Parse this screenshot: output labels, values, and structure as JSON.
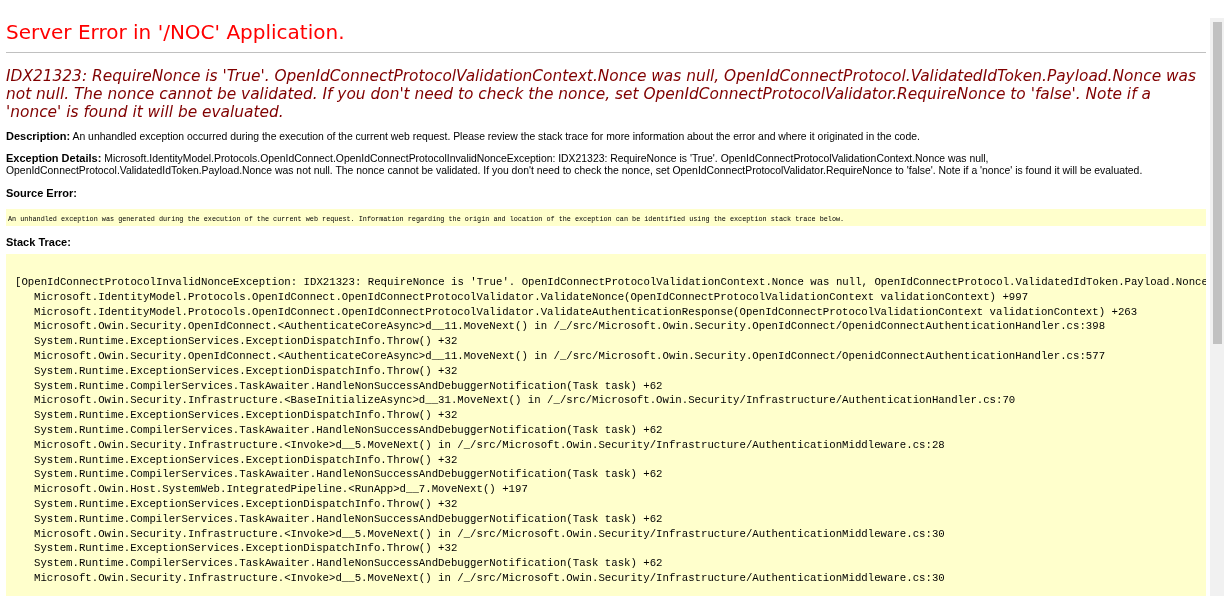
{
  "title": "Server Error in '/NOC' Application.",
  "message": "IDX21323: RequireNonce is 'True'. OpenIdConnectProtocolValidationContext.Nonce was null, OpenIdConnectProtocol.ValidatedIdToken.Payload.Nonce was not null. The nonce cannot be validated. If you don't need to check the nonce, set OpenIdConnectProtocolValidator.RequireNonce to 'false'. Note if a 'nonce' is found it will be evaluated.",
  "description": {
    "label": "Description:",
    "text": "An unhandled exception occurred during the execution of the current web request. Please review the stack trace for more information about the error and where it originated in the code."
  },
  "exception_details": {
    "label": "Exception Details:",
    "text": "Microsoft.IdentityModel.Protocols.OpenIdConnect.OpenIdConnectProtocolInvalidNonceException: IDX21323: RequireNonce is 'True'. OpenIdConnectProtocolValidationContext.Nonce was null, OpenIdConnectProtocol.ValidatedIdToken.Payload.Nonce was not null. The nonce cannot be validated. If you don't need to check the nonce, set OpenIdConnectProtocolValidator.RequireNonce to 'false'. Note if a 'nonce' is found it will be evaluated."
  },
  "source_error": {
    "label": "Source Error:",
    "text": "An unhandled exception was generated during the execution of the current web request. Information regarding the origin and location of the exception can be identified using the exception stack trace below."
  },
  "stack_trace": {
    "label": "Stack Trace:",
    "exception": "[OpenIdConnectProtocolInvalidNonceException: IDX21323: RequireNonce is 'True'. OpenIdConnectProtocolValidationContext.Nonce was null, OpenIdConnectProtocol.ValidatedIdToken.Payload.Nonce",
    "frames": [
      "Microsoft.IdentityModel.Protocols.OpenIdConnect.OpenIdConnectProtocolValidator.ValidateNonce(OpenIdConnectProtocolValidationContext validationContext) +997",
      "Microsoft.IdentityModel.Protocols.OpenIdConnect.OpenIdConnectProtocolValidator.ValidateAuthenticationResponse(OpenIdConnectProtocolValidationContext validationContext) +263",
      "Microsoft.Owin.Security.OpenIdConnect.<AuthenticateCoreAsync>d__11.MoveNext() in /_/src/Microsoft.Owin.Security.OpenIdConnect/OpenidConnectAuthenticationHandler.cs:398",
      "System.Runtime.ExceptionServices.ExceptionDispatchInfo.Throw() +32",
      "Microsoft.Owin.Security.OpenIdConnect.<AuthenticateCoreAsync>d__11.MoveNext() in /_/src/Microsoft.Owin.Security.OpenIdConnect/OpenidConnectAuthenticationHandler.cs:577",
      "System.Runtime.ExceptionServices.ExceptionDispatchInfo.Throw() +32",
      "System.Runtime.CompilerServices.TaskAwaiter.HandleNonSuccessAndDebuggerNotification(Task task) +62",
      "Microsoft.Owin.Security.Infrastructure.<BaseInitializeAsync>d__31.MoveNext() in /_/src/Microsoft.Owin.Security/Infrastructure/AuthenticationHandler.cs:70",
      "System.Runtime.ExceptionServices.ExceptionDispatchInfo.Throw() +32",
      "System.Runtime.CompilerServices.TaskAwaiter.HandleNonSuccessAndDebuggerNotification(Task task) +62",
      "Microsoft.Owin.Security.Infrastructure.<Invoke>d__5.MoveNext() in /_/src/Microsoft.Owin.Security/Infrastructure/AuthenticationMiddleware.cs:28",
      "System.Runtime.ExceptionServices.ExceptionDispatchInfo.Throw() +32",
      "System.Runtime.CompilerServices.TaskAwaiter.HandleNonSuccessAndDebuggerNotification(Task task) +62",
      "Microsoft.Owin.Host.SystemWeb.IntegratedPipeline.<RunApp>d__7.MoveNext() +197",
      "System.Runtime.ExceptionServices.ExceptionDispatchInfo.Throw() +32",
      "System.Runtime.CompilerServices.TaskAwaiter.HandleNonSuccessAndDebuggerNotification(Task task) +62",
      "Microsoft.Owin.Security.Infrastructure.<Invoke>d__5.MoveNext() in /_/src/Microsoft.Owin.Security/Infrastructure/AuthenticationMiddleware.cs:30",
      "System.Runtime.ExceptionServices.ExceptionDispatchInfo.Throw() +32",
      "System.Runtime.CompilerServices.TaskAwaiter.HandleNonSuccessAndDebuggerNotification(Task task) +62",
      "Microsoft.Owin.Security.Infrastructure.<Invoke>d__5.MoveNext() in /_/src/Microsoft.Owin.Security/Infrastructure/AuthenticationMiddleware.cs:30"
    ]
  }
}
